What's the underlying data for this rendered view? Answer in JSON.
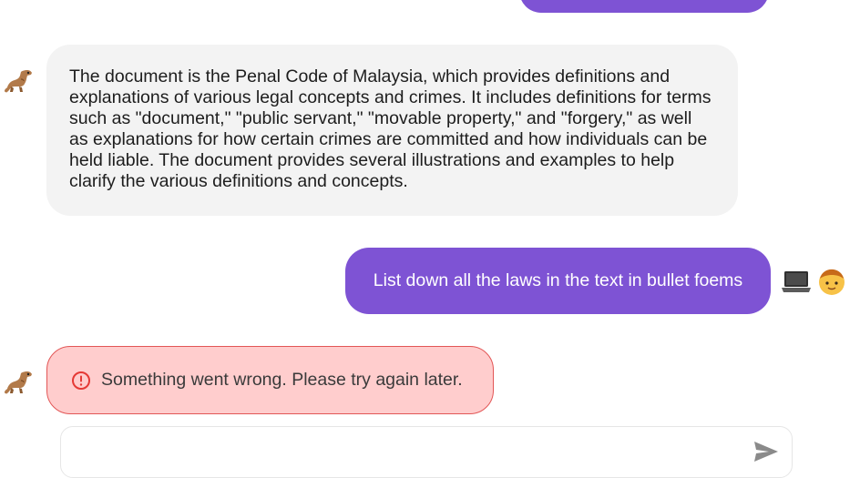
{
  "messages": [
    {
      "role": "user",
      "text": ""
    },
    {
      "role": "assistant",
      "avatar": "dinosaur-emoji-icon",
      "text": "The document is the Penal Code of Malaysia, which provides definitions and explanations of various legal concepts and crimes. It includes definitions for terms such as \"document,\" \"public servant,\" \"movable property,\" and \"forgery,\" as well as explanations for how certain crimes are committed and how individuals can be held liable. The document provides several illustrations and examples to help clarify the various definitions and concepts."
    },
    {
      "role": "user",
      "icons": [
        "laptop-emoji-icon",
        "person-emoji-icon"
      ],
      "text": "List down all the laws in the text in bullet foems"
    },
    {
      "role": "assistant",
      "avatar": "dinosaur-emoji-icon",
      "status": "error",
      "error_icon": "alert-circle-icon",
      "text": "Something went wrong. Please try again later."
    }
  ],
  "composer": {
    "value": "",
    "placeholder": "",
    "send_icon": "send-icon"
  },
  "colors": {
    "user_bubble": "#7e53d4",
    "assistant_bubble": "#f3f3f3",
    "error_bubble": "#ffcdcd",
    "error_border": "#e25656",
    "error_icon": "#e53935",
    "send_icon": "#8a8a8a"
  }
}
